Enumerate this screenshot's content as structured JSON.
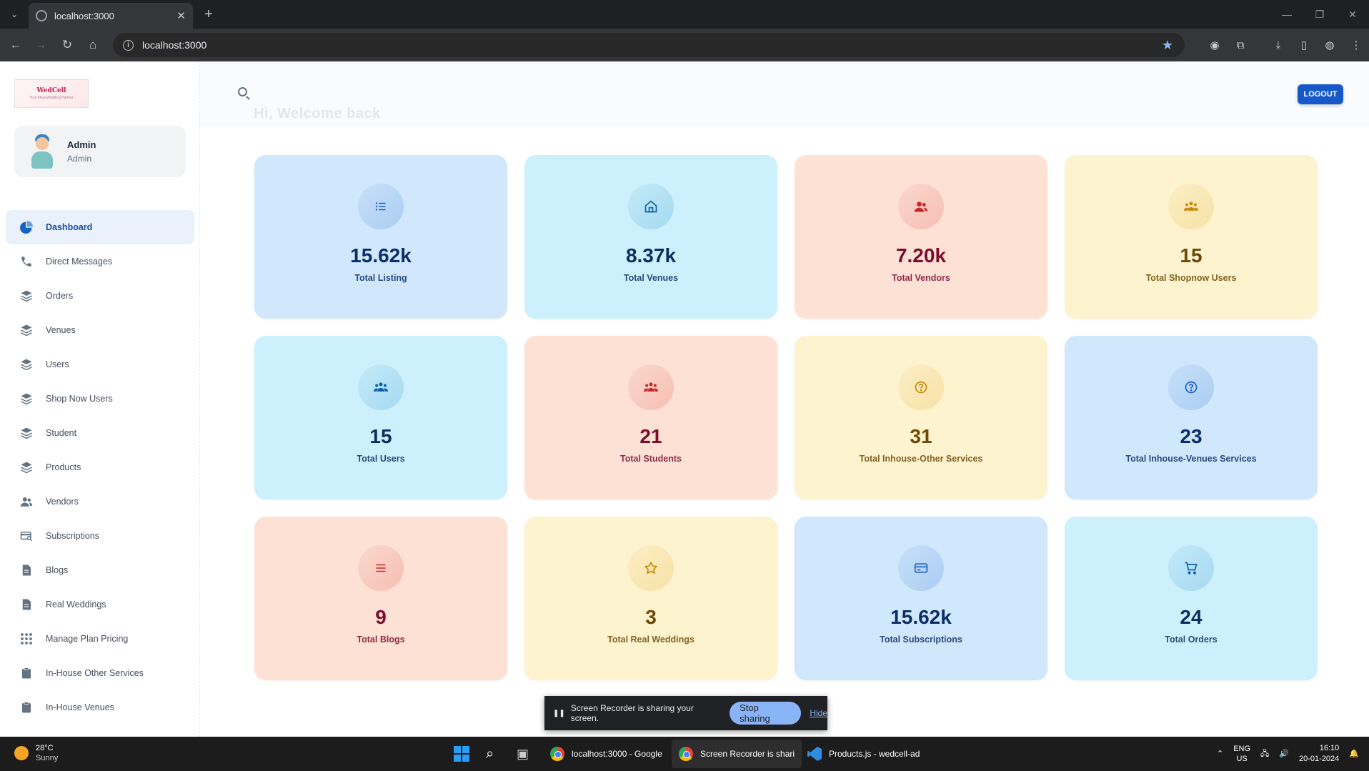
{
  "browser": {
    "tab_title": "localhost:3000",
    "url": "localhost:3000",
    "new_tab_symbol": "+",
    "close_symbol": "✕"
  },
  "sidebar": {
    "logo_text": "WedCell",
    "logo_tagline": "Your Ideal Wedding Partner",
    "account": {
      "name": "Admin",
      "role": "Admin"
    },
    "items": [
      {
        "label": "Dashboard",
        "icon": "pie-chart-icon",
        "active": true
      },
      {
        "label": "Direct Messages",
        "icon": "phone-icon"
      },
      {
        "label": "Orders",
        "icon": "layers-icon"
      },
      {
        "label": "Venues",
        "icon": "layers-icon"
      },
      {
        "label": "Users",
        "icon": "layers-icon"
      },
      {
        "label": "Shop Now Users",
        "icon": "layers-icon"
      },
      {
        "label": "Student",
        "icon": "layers-icon"
      },
      {
        "label": "Products",
        "icon": "layers-icon"
      },
      {
        "label": "Vendors",
        "icon": "people-icon"
      },
      {
        "label": "Subscriptions",
        "icon": "card-search-icon"
      },
      {
        "label": "Blogs",
        "icon": "document-icon"
      },
      {
        "label": "Real Weddings",
        "icon": "document-icon"
      },
      {
        "label": "Manage Plan Pricing",
        "icon": "grid-dots-icon"
      },
      {
        "label": "In-House Other Services",
        "icon": "clipboard-icon"
      },
      {
        "label": "In-House Venues",
        "icon": "clipboard-icon"
      }
    ]
  },
  "header": {
    "welcome": "Hi, Welcome back",
    "logout_label": "LOGOUT"
  },
  "cards": [
    {
      "value": "15.62k",
      "label": "Total Listing",
      "icon": "list-icon",
      "theme": "blue"
    },
    {
      "value": "8.37k",
      "label": "Total Venues",
      "icon": "home-icon",
      "theme": "cyan"
    },
    {
      "value": "7.20k",
      "label": "Total Vendors",
      "icon": "people-icon",
      "theme": "red"
    },
    {
      "value": "15",
      "label": "Total Shopnow Users",
      "icon": "group-icon",
      "theme": "yellow"
    },
    {
      "value": "15",
      "label": "Total Users",
      "icon": "group-icon",
      "theme": "cyan"
    },
    {
      "value": "21",
      "label": "Total Students",
      "icon": "group-icon",
      "theme": "red"
    },
    {
      "value": "31",
      "label": "Total Inhouse-Other Services",
      "icon": "question-icon",
      "theme": "yellow"
    },
    {
      "value": "23",
      "label": "Total Inhouse-Venues Services",
      "icon": "question-icon",
      "theme": "blue"
    },
    {
      "value": "9",
      "label": "Total Blogs",
      "icon": "list-icon",
      "theme": "red"
    },
    {
      "value": "3",
      "label": "Total Real Weddings",
      "icon": "star-icon",
      "theme": "yellow"
    },
    {
      "value": "15.62k",
      "label": "Total Subscriptions",
      "icon": "credit-card-icon",
      "theme": "blue"
    },
    {
      "value": "24",
      "label": "Total Orders",
      "icon": "cart-icon",
      "theme": "cyan"
    }
  ],
  "recorder": {
    "message": "Screen Recorder is sharing your screen.",
    "stop_label": "Stop sharing",
    "hide_label": "Hide"
  },
  "taskbar": {
    "weather_temp": "28°C",
    "weather_cond": "Sunny",
    "apps": [
      {
        "label": "localhost:3000 - Google"
      },
      {
        "label": "Screen Recorder is shari"
      },
      {
        "label": "Products.js - wedcell-ad"
      }
    ],
    "lang_top": "ENG",
    "lang_bottom": "US",
    "time": "16:10",
    "date": "20-01-2024"
  },
  "colors": {
    "accent": "#1758c9",
    "blue_card": "#d1e7fb",
    "cyan_card": "#ccf1fc",
    "red_card": "#fde1d5",
    "yellow_card": "#fef3cf"
  }
}
